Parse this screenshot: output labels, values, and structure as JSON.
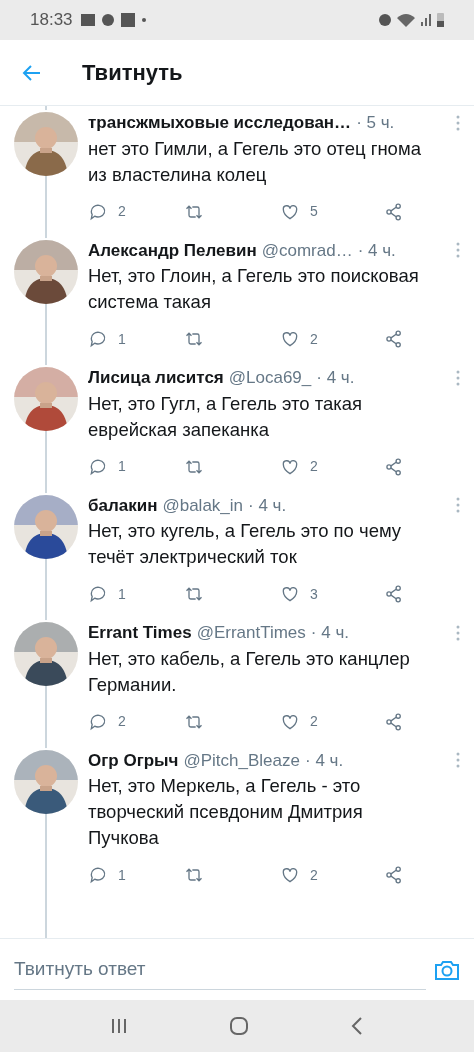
{
  "status_bar": {
    "time": "18:33"
  },
  "header": {
    "title": "Твитнуть"
  },
  "tweets": [
    {
      "name": "трансжмыховые исследован…",
      "time": "· 5 ч.",
      "text": "нет это Гимли, а Гегель это отец гнома из властелина колец",
      "replies": "2",
      "likes": "5"
    },
    {
      "name": "Александр Пелевин",
      "handle": "@comrad…",
      "time": "· 4 ч.",
      "text": "Нет, это Глоин, а Гегель это поисковая система такая",
      "replies": "1",
      "likes": "2"
    },
    {
      "name": "Лисица лисится",
      "handle": "@Loca69_",
      "time": "· 4 ч.",
      "text": "Нет, это Гугл, а Гегель это такая еврейская запеканка",
      "replies": "1",
      "likes": "2"
    },
    {
      "name": "балакин",
      "handle": "@balak_in",
      "time": "· 4 ч.",
      "text": "Нет, это кугель, а Гегель это по чему течёт электрический ток",
      "replies": "1",
      "likes": "3"
    },
    {
      "name": "Errant Times",
      "handle": "@ErrantTimes",
      "time": "· 4 ч.",
      "text": "Нет, это кабель, а Гегель это канцлер Германии.",
      "replies": "2",
      "likes": "2"
    },
    {
      "name": "Огр Огрыч",
      "handle": "@Pitch_Bleaze",
      "time": "· 4 ч.",
      "text": "Нет, это Меркель, а Гегель - это творческий псевдоним Дмитрия Пучкова",
      "replies": "1",
      "likes": "2"
    }
  ],
  "reply_bar": {
    "placeholder": "Твитнуть ответ"
  }
}
